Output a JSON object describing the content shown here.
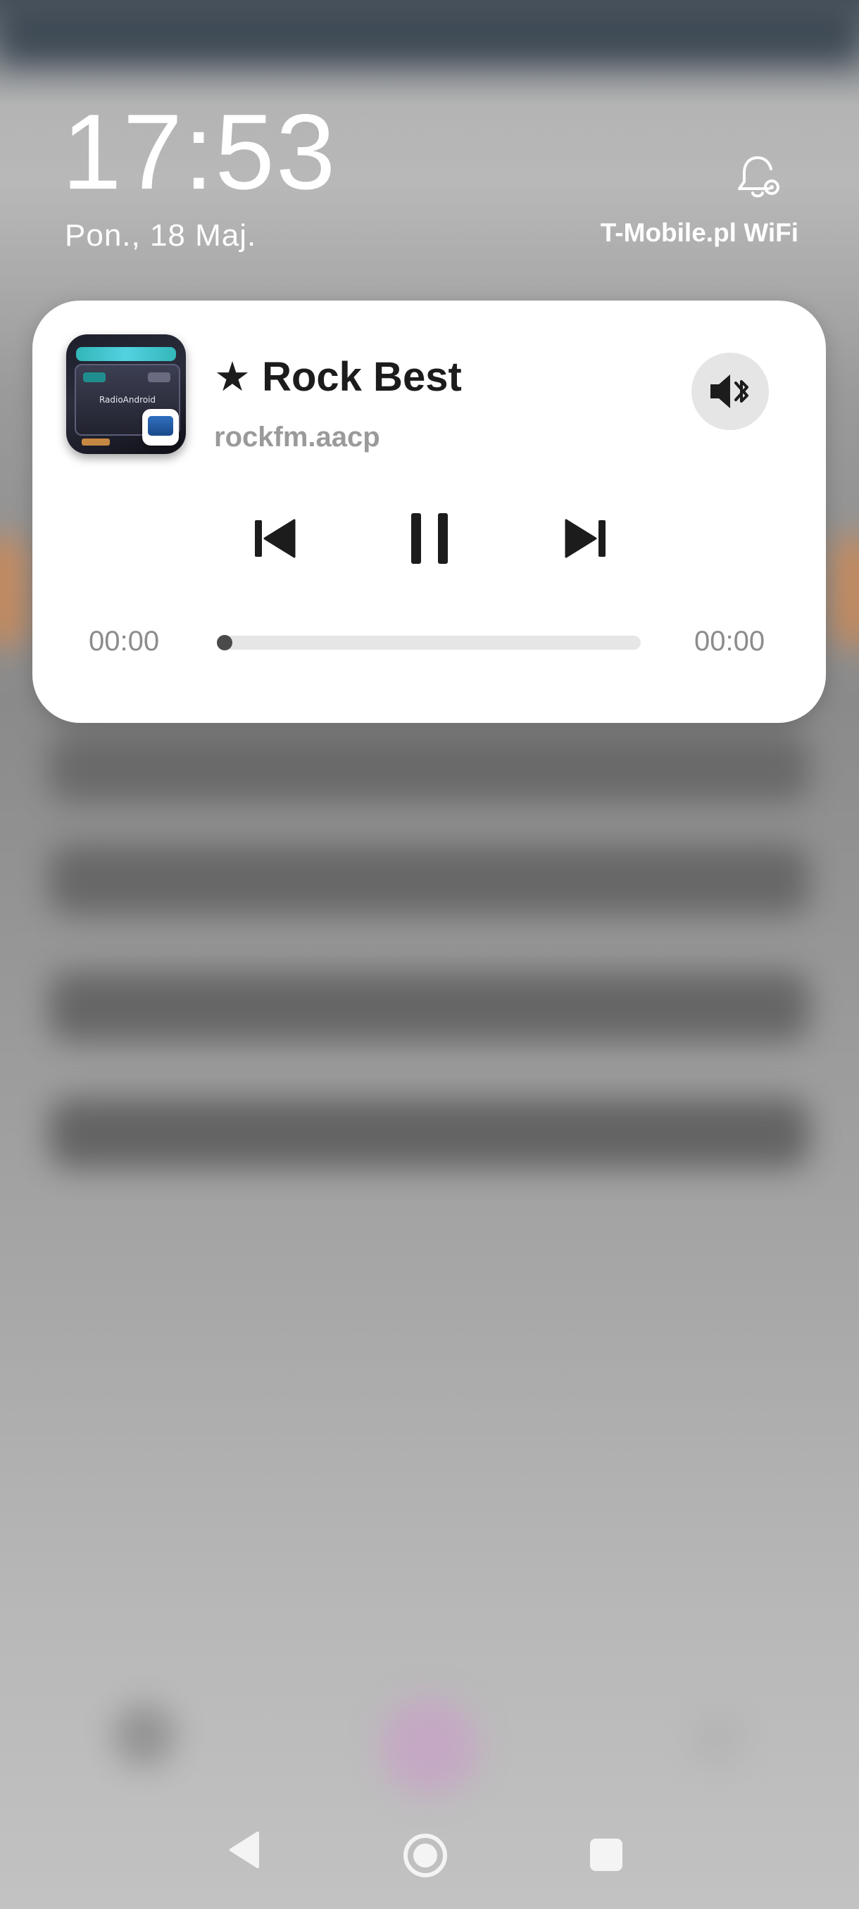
{
  "lockscreen": {
    "time": "17:53",
    "date": "Pon., 18 Maj.",
    "network": "T-Mobile.pl WiFi",
    "notification_icon": "bell-settings-icon"
  },
  "media_player": {
    "title": "★ Rock Best",
    "subtitle": "rockfm.aacp",
    "artwork_text": "RadioAndroid",
    "output_icon": "speaker-bluetooth-icon",
    "controls": {
      "previous_icon": "skip-previous-icon",
      "pause_icon": "pause-icon",
      "next_icon": "skip-next-icon"
    },
    "elapsed": "00:00",
    "duration": "00:00",
    "progress_fraction": 0.0
  },
  "navigation": {
    "back_icon": "back-icon",
    "home_icon": "home-icon",
    "recents_icon": "recents-icon"
  },
  "colors": {
    "card_background": "#ffffff",
    "title": "#1c1c1c",
    "secondary_text": "#9a9a9a",
    "progress_track": "#e6e6e6",
    "progress_fill": "#4a4a4a"
  }
}
